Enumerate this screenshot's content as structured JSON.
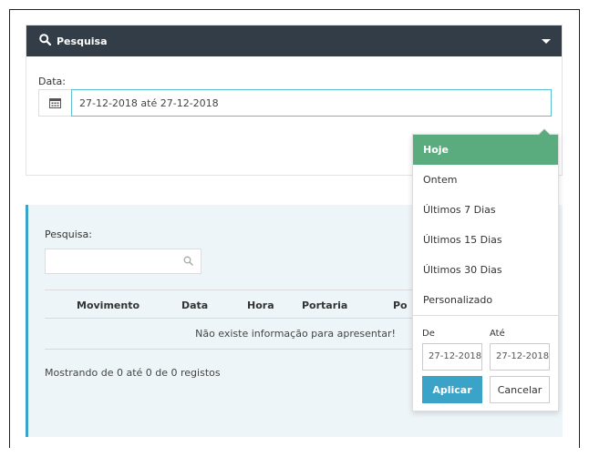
{
  "search_panel": {
    "title": "Pesquisa",
    "date_label": "Data:",
    "date_value": "27-12-2018 até 27-12-2018"
  },
  "results": {
    "search_label": "Pesquisa:",
    "search_value": "",
    "columns": [
      "Movimento",
      "Data",
      "Hora",
      "Portaria",
      "Po"
    ],
    "empty_message": "Não existe informação para apresentar!",
    "info": "Mostrando de 0 até 0 de 0 registos"
  },
  "date_picker": {
    "ranges": [
      "Hoje",
      "Ontem",
      "Últimos 7 Dias",
      "Últimos 15 Dias",
      "Últimos 30 Dias",
      "Personalizado"
    ],
    "active_range": "Hoje",
    "from_label": "De",
    "to_label": "Até",
    "from_value": "27-12-2018",
    "to_value": "27-12-2018",
    "apply_label": "Aplicar",
    "cancel_label": "Cancelar"
  },
  "colors": {
    "header_bg": "#333d47",
    "active_range": "#5aac7f",
    "apply_button": "#3aa3c7",
    "results_bg": "#eef5f8"
  },
  "icons": {
    "search": "search-icon",
    "calendar": "calendar-icon",
    "collapse": "caret-down-icon"
  }
}
